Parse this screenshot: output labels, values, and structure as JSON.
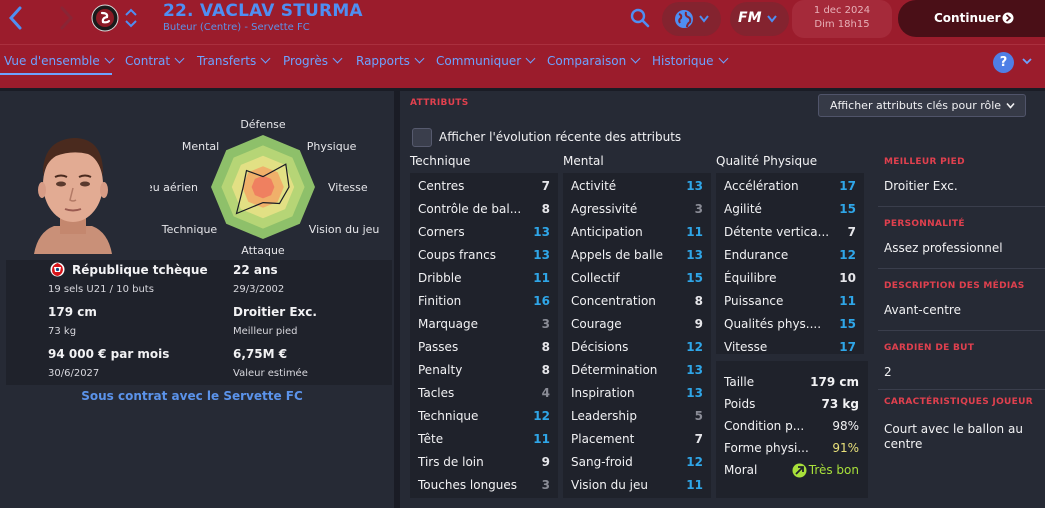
{
  "header": {
    "player_name": "22. VACLAV STURMA",
    "player_role": "Buteur (Centre) - Servette FC",
    "date_line1": "1 dec 2024",
    "date_line2": "Dim 18h15",
    "continue_label": "Continuer",
    "fm_logo": "FM",
    "help_label": "?",
    "colors": {
      "header_bg": "#9b1c2c",
      "accent_blue": "#4f8ef2",
      "continue_bg": "#4a0f17"
    }
  },
  "nav": {
    "tabs": [
      "Vue d'ensemble",
      "Contrat",
      "Transferts",
      "Progrès",
      "Rapports",
      "Communiquer",
      "Comparaison",
      "Historique"
    ],
    "active": "Vue d'ensemble"
  },
  "profile": {
    "radar_labels": [
      "Défense",
      "Physique",
      "Vitesse",
      "Vision du jeu",
      "Attaque",
      "Technique",
      "Jeu aérien",
      "Mental"
    ],
    "radar_values": [
      0.2,
      0.62,
      0.5,
      0.45,
      0.3,
      0.72,
      0.38,
      0.45
    ],
    "nationality": "République tchèque",
    "caps": "19 sels U21 / 10 buts",
    "age": "22 ans",
    "dob": "29/3/2002",
    "height": "179 cm",
    "weight": "73 kg",
    "foot": "Droitier Exc.",
    "foot_label": "Meilleur pied",
    "wage": "94 000 € par mois",
    "contract_end": "30/6/2027",
    "value": "6,75M €",
    "value_label": "Valeur estimée",
    "contract_status": "Sous contrat avec le Servette FC"
  },
  "attributes": {
    "title": "ATTRIBUTS",
    "dropdown": "Afficher attributs clés pour rôle",
    "evolution_toggle": "Afficher l'évolution récente des attributs",
    "technique_header": "Technique",
    "mental_header": "Mental",
    "physical_header": "Qualité Physique",
    "technique": [
      {
        "name": "Centres",
        "value": 7
      },
      {
        "name": "Contrôle de bal...",
        "value": 8
      },
      {
        "name": "Corners",
        "value": 13
      },
      {
        "name": "Coups francs",
        "value": 13
      },
      {
        "name": "Dribble",
        "value": 11
      },
      {
        "name": "Finition",
        "value": 16
      },
      {
        "name": "Marquage",
        "value": 3
      },
      {
        "name": "Passes",
        "value": 8
      },
      {
        "name": "Penalty",
        "value": 8
      },
      {
        "name": "Tacles",
        "value": 4
      },
      {
        "name": "Technique",
        "value": 12
      },
      {
        "name": "Tête",
        "value": 11
      },
      {
        "name": "Tirs de loin",
        "value": 9
      },
      {
        "name": "Touches longues",
        "value": 3
      }
    ],
    "mental": [
      {
        "name": "Activité",
        "value": 13
      },
      {
        "name": "Agressivité",
        "value": 3
      },
      {
        "name": "Anticipation",
        "value": 11
      },
      {
        "name": "Appels de balle",
        "value": 13
      },
      {
        "name": "Collectif",
        "value": 15
      },
      {
        "name": "Concentration",
        "value": 8
      },
      {
        "name": "Courage",
        "value": 9
      },
      {
        "name": "Décisions",
        "value": 12
      },
      {
        "name": "Détermination",
        "value": 13
      },
      {
        "name": "Inspiration",
        "value": 13
      },
      {
        "name": "Leadership",
        "value": 5
      },
      {
        "name": "Placement",
        "value": 7
      },
      {
        "name": "Sang-froid",
        "value": 12
      },
      {
        "name": "Vision du jeu",
        "value": 11
      }
    ],
    "physical": [
      {
        "name": "Accélération",
        "value": 17
      },
      {
        "name": "Agilité",
        "value": 15
      },
      {
        "name": "Détente vertica...",
        "value": 7
      },
      {
        "name": "Endurance",
        "value": 12
      },
      {
        "name": "Équilibre",
        "value": 10
      },
      {
        "name": "Puissance",
        "value": 11
      },
      {
        "name": "Qualités phys....",
        "value": 15
      },
      {
        "name": "Vitesse",
        "value": 17
      }
    ],
    "physical_extra": [
      {
        "name": "Taille",
        "value": "179 cm"
      },
      {
        "name": "Poids",
        "value": "73 kg"
      },
      {
        "name": "Condition p...",
        "value": "98%"
      },
      {
        "name": "Forme physi...",
        "value": "91%"
      },
      {
        "name": "Moral",
        "value": "Très bon"
      }
    ],
    "colors": {
      "low": "#8a8c96",
      "mid": "#e6e6ea",
      "high": "#2fa6e8",
      "moral": "#a8e03a",
      "form": "#e8e07a"
    }
  },
  "side_info": [
    {
      "heading": "MEILLEUR PIED",
      "value": "Droitier Exc."
    },
    {
      "heading": "PERSONNALITÉ",
      "value": "Assez professionnel"
    },
    {
      "heading": "DESCRIPTION DES MÉDIAS",
      "value": "Avant-centre"
    },
    {
      "heading": "GARDIEN DE BUT",
      "value": "2"
    },
    {
      "heading": "CARACTÉRISTIQUES JOUEUR",
      "value": "Court avec le ballon au centre"
    }
  ]
}
